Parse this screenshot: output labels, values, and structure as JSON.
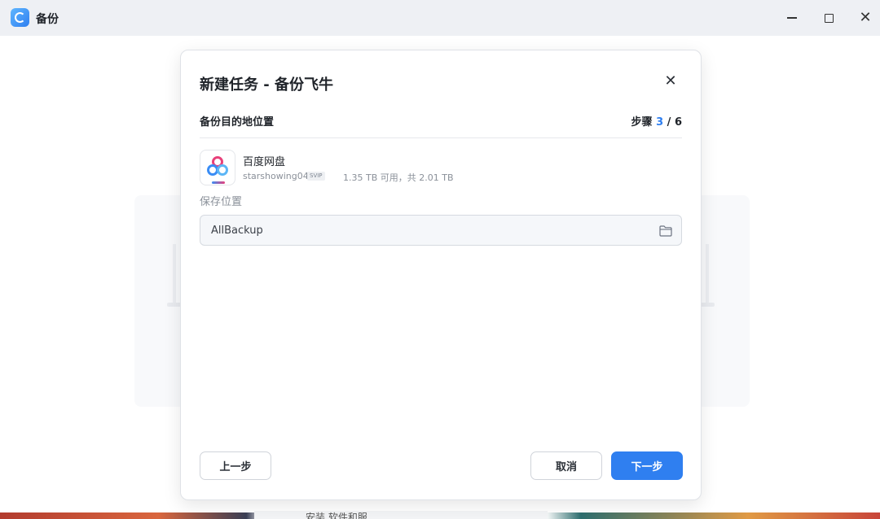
{
  "window": {
    "app_title": "备份",
    "app_icon": "backup-app-icon",
    "controls": [
      "minimize-icon",
      "maximize-icon",
      "close-icon"
    ],
    "close_glyph": "✕"
  },
  "dialog": {
    "title": "新建任务 - 备份飞牛",
    "close_glyph": "✕",
    "section_label": "备份目的地位置",
    "steps": {
      "prefix": "步骤",
      "current": "3",
      "separator": "/",
      "total": "6"
    },
    "destination": {
      "icon": "baidu-netdisk-icon",
      "name": "百度网盘",
      "account": "starshowing04",
      "badge": "SVIP",
      "usage": "1.35 TB 可用，共 2.01 TB"
    },
    "save_location": {
      "label": "保存位置",
      "value": "AllBackup",
      "icon": "folder-icon"
    },
    "buttons": {
      "prev": "上一步",
      "cancel": "取消",
      "next": "下一步"
    }
  },
  "desktop": {
    "partial_text": "安装 软件和服"
  },
  "colors": {
    "accent": "#2f7ff0",
    "titlebar_bg": "#eef0f4"
  }
}
